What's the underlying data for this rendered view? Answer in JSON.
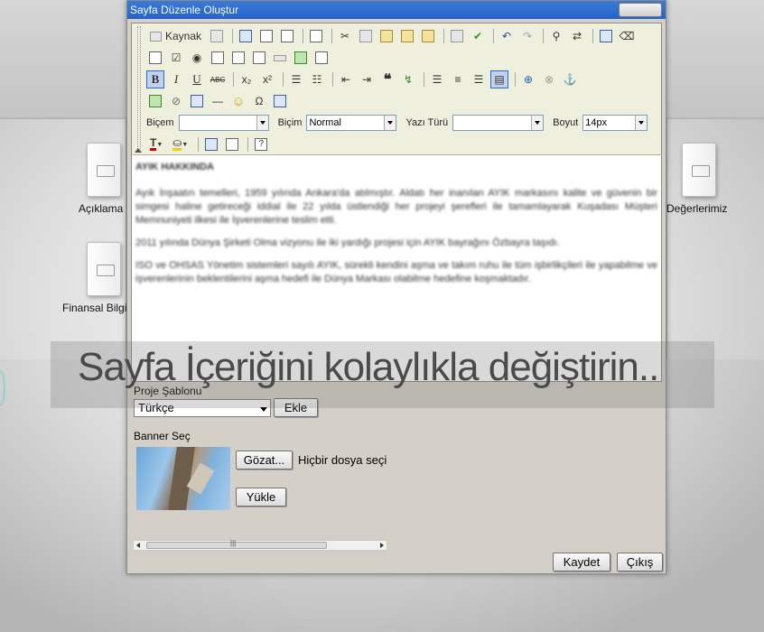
{
  "dialog": {
    "title": "Sayfa Düzenle Oluştur"
  },
  "toolbar": {
    "source_label": "Kaynak",
    "bold": "B",
    "italic": "I",
    "underline": "U",
    "strike": "ABC",
    "style_label": "Biçem",
    "format_label": "Biçim",
    "format_value": "Normal",
    "font_label": "Yazı Türü",
    "size_label": "Boyut",
    "size_value": "14px"
  },
  "editor_content": {
    "heading": "AYIK HAKKINDA",
    "paragraphs": [
      "Ayık İnşaatın temelleri, 1959 yılında Ankara'da atılmıştır. Aldatı her inanılan AYIK markasını kalite ve güvenin bir simgesi haline getireceği iddial ile 22 yılda üstlendiği her projeyi şerefleri ile tamamlayarak Kuşadası Müşteri Memnuniyeti ilkesi ile İşverenlerine teslim etti.",
      "2011 yılında Dünya Şirketi Olma vizyonu ile iki yardığı projesi için AYIK bayrağını Özbayra taşıdı.",
      "ISO ve OHSAS Yönetim sistemleri sayılı AYIK, sürekli kendini aşma ve takım ruhu ile tüm işbirlikçileri ile yapabilme ve işverenlerinin beklentilerini aşma hedefi ile Dünya Markası olabilme hedefine koşmaktadır."
    ]
  },
  "overlay_caption": "Sayfa İçeriğini kolaylıkla değiştirin..",
  "form": {
    "template_label": "Proje Şablonu",
    "template_value": "Türkçe",
    "add_button": "Ekle",
    "banner_label": "Banner Seç",
    "browse_button": "Gözat...",
    "file_status": "Hiçbir dosya seçilmedi",
    "upload_button": "Yükle",
    "save_button": "Kaydet",
    "exit_button": "Çıkış"
  },
  "desktop_icons": {
    "description": "Açıklama",
    "values": "Değerlerimiz",
    "financial": "Finansal Bilgiler"
  }
}
